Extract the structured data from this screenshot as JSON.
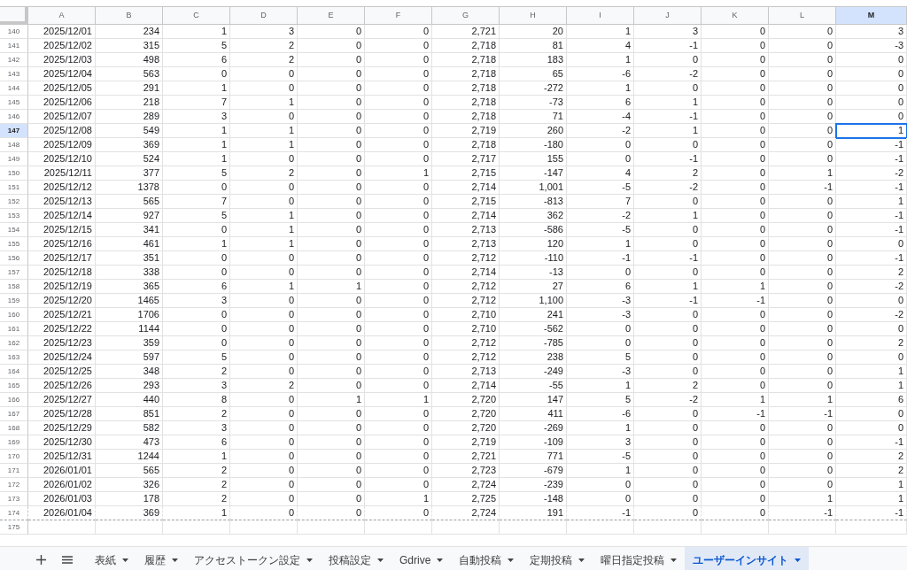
{
  "columns": [
    {
      "label": "A",
      "selected": false
    },
    {
      "label": "B",
      "selected": false
    },
    {
      "label": "C",
      "selected": false
    },
    {
      "label": "D",
      "selected": false
    },
    {
      "label": "E",
      "selected": false
    },
    {
      "label": "F",
      "selected": false
    },
    {
      "label": "G",
      "selected": false
    },
    {
      "label": "H",
      "selected": false
    },
    {
      "label": "I",
      "selected": false
    },
    {
      "label": "J",
      "selected": false
    },
    {
      "label": "K",
      "selected": false
    },
    {
      "label": "L",
      "selected": false
    },
    {
      "label": "M",
      "selected": true
    }
  ],
  "rows": [
    {
      "n": "140",
      "selected": false,
      "cells": [
        "2025/12/01",
        "234",
        "1",
        "3",
        "0",
        "0",
        "2,721",
        "20",
        "1",
        "3",
        "0",
        "0",
        "3"
      ]
    },
    {
      "n": "141",
      "selected": false,
      "cells": [
        "2025/12/02",
        "315",
        "5",
        "2",
        "0",
        "0",
        "2,718",
        "81",
        "4",
        "-1",
        "0",
        "0",
        "-3"
      ]
    },
    {
      "n": "142",
      "selected": false,
      "cells": [
        "2025/12/03",
        "498",
        "6",
        "2",
        "0",
        "0",
        "2,718",
        "183",
        "1",
        "0",
        "0",
        "0",
        "0"
      ]
    },
    {
      "n": "143",
      "selected": false,
      "cells": [
        "2025/12/04",
        "563",
        "0",
        "0",
        "0",
        "0",
        "2,718",
        "65",
        "-6",
        "-2",
        "0",
        "0",
        "0"
      ]
    },
    {
      "n": "144",
      "selected": false,
      "cells": [
        "2025/12/05",
        "291",
        "1",
        "0",
        "0",
        "0",
        "2,718",
        "-272",
        "1",
        "0",
        "0",
        "0",
        "0"
      ]
    },
    {
      "n": "145",
      "selected": false,
      "cells": [
        "2025/12/06",
        "218",
        "7",
        "1",
        "0",
        "0",
        "2,718",
        "-73",
        "6",
        "1",
        "0",
        "0",
        "0"
      ]
    },
    {
      "n": "146",
      "selected": false,
      "cells": [
        "2025/12/07",
        "289",
        "3",
        "0",
        "0",
        "0",
        "2,718",
        "71",
        "-4",
        "-1",
        "0",
        "0",
        "0"
      ]
    },
    {
      "n": "147",
      "selected": true,
      "cells": [
        "2025/12/08",
        "549",
        "1",
        "1",
        "0",
        "0",
        "2,719",
        "260",
        "-2",
        "1",
        "0",
        "0",
        "1"
      ]
    },
    {
      "n": "148",
      "selected": false,
      "cells": [
        "2025/12/09",
        "369",
        "1",
        "1",
        "0",
        "0",
        "2,718",
        "-180",
        "0",
        "0",
        "0",
        "0",
        "-1"
      ]
    },
    {
      "n": "149",
      "selected": false,
      "cells": [
        "2025/12/10",
        "524",
        "1",
        "0",
        "0",
        "0",
        "2,717",
        "155",
        "0",
        "-1",
        "0",
        "0",
        "-1"
      ]
    },
    {
      "n": "150",
      "selected": false,
      "cells": [
        "2025/12/11",
        "377",
        "5",
        "2",
        "0",
        "1",
        "2,715",
        "-147",
        "4",
        "2",
        "0",
        "1",
        "-2"
      ]
    },
    {
      "n": "151",
      "selected": false,
      "cells": [
        "2025/12/12",
        "1378",
        "0",
        "0",
        "0",
        "0",
        "2,714",
        "1,001",
        "-5",
        "-2",
        "0",
        "-1",
        "-1"
      ]
    },
    {
      "n": "152",
      "selected": false,
      "cells": [
        "2025/12/13",
        "565",
        "7",
        "0",
        "0",
        "0",
        "2,715",
        "-813",
        "7",
        "0",
        "0",
        "0",
        "1"
      ]
    },
    {
      "n": "153",
      "selected": false,
      "cells": [
        "2025/12/14",
        "927",
        "5",
        "1",
        "0",
        "0",
        "2,714",
        "362",
        "-2",
        "1",
        "0",
        "0",
        "-1"
      ]
    },
    {
      "n": "154",
      "selected": false,
      "cells": [
        "2025/12/15",
        "341",
        "0",
        "1",
        "0",
        "0",
        "2,713",
        "-586",
        "-5",
        "0",
        "0",
        "0",
        "-1"
      ]
    },
    {
      "n": "155",
      "selected": false,
      "cells": [
        "2025/12/16",
        "461",
        "1",
        "1",
        "0",
        "0",
        "2,713",
        "120",
        "1",
        "0",
        "0",
        "0",
        "0"
      ]
    },
    {
      "n": "156",
      "selected": false,
      "cells": [
        "2025/12/17",
        "351",
        "0",
        "0",
        "0",
        "0",
        "2,712",
        "-110",
        "-1",
        "-1",
        "0",
        "0",
        "-1"
      ]
    },
    {
      "n": "157",
      "selected": false,
      "cells": [
        "2025/12/18",
        "338",
        "0",
        "0",
        "0",
        "0",
        "2,714",
        "-13",
        "0",
        "0",
        "0",
        "0",
        "2"
      ]
    },
    {
      "n": "158",
      "selected": false,
      "cells": [
        "2025/12/19",
        "365",
        "6",
        "1",
        "1",
        "0",
        "2,712",
        "27",
        "6",
        "1",
        "1",
        "0",
        "-2"
      ]
    },
    {
      "n": "159",
      "selected": false,
      "cells": [
        "2025/12/20",
        "1465",
        "3",
        "0",
        "0",
        "0",
        "2,712",
        "1,100",
        "-3",
        "-1",
        "-1",
        "0",
        "0"
      ]
    },
    {
      "n": "160",
      "selected": false,
      "cells": [
        "2025/12/21",
        "1706",
        "0",
        "0",
        "0",
        "0",
        "2,710",
        "241",
        "-3",
        "0",
        "0",
        "0",
        "-2"
      ]
    },
    {
      "n": "161",
      "selected": false,
      "cells": [
        "2025/12/22",
        "1144",
        "0",
        "0",
        "0",
        "0",
        "2,710",
        "-562",
        "0",
        "0",
        "0",
        "0",
        "0"
      ]
    },
    {
      "n": "162",
      "selected": false,
      "cells": [
        "2025/12/23",
        "359",
        "0",
        "0",
        "0",
        "0",
        "2,712",
        "-785",
        "0",
        "0",
        "0",
        "0",
        "2"
      ]
    },
    {
      "n": "163",
      "selected": false,
      "cells": [
        "2025/12/24",
        "597",
        "5",
        "0",
        "0",
        "0",
        "2,712",
        "238",
        "5",
        "0",
        "0",
        "0",
        "0"
      ]
    },
    {
      "n": "164",
      "selected": false,
      "cells": [
        "2025/12/25",
        "348",
        "2",
        "0",
        "0",
        "0",
        "2,713",
        "-249",
        "-3",
        "0",
        "0",
        "0",
        "1"
      ]
    },
    {
      "n": "165",
      "selected": false,
      "cells": [
        "2025/12/26",
        "293",
        "3",
        "2",
        "0",
        "0",
        "2,714",
        "-55",
        "1",
        "2",
        "0",
        "0",
        "1"
      ]
    },
    {
      "n": "166",
      "selected": false,
      "cells": [
        "2025/12/27",
        "440",
        "8",
        "0",
        "1",
        "1",
        "2,720",
        "147",
        "5",
        "-2",
        "1",
        "1",
        "6"
      ]
    },
    {
      "n": "167",
      "selected": false,
      "cells": [
        "2025/12/28",
        "851",
        "2",
        "0",
        "0",
        "0",
        "2,720",
        "411",
        "-6",
        "0",
        "-1",
        "-1",
        "0"
      ]
    },
    {
      "n": "168",
      "selected": false,
      "cells": [
        "2025/12/29",
        "582",
        "3",
        "0",
        "0",
        "0",
        "2,720",
        "-269",
        "1",
        "0",
        "0",
        "0",
        "0"
      ]
    },
    {
      "n": "169",
      "selected": false,
      "cells": [
        "2025/12/30",
        "473",
        "6",
        "0",
        "0",
        "0",
        "2,719",
        "-109",
        "3",
        "0",
        "0",
        "0",
        "-1"
      ]
    },
    {
      "n": "170",
      "selected": false,
      "cells": [
        "2025/12/31",
        "1244",
        "1",
        "0",
        "0",
        "0",
        "2,721",
        "771",
        "-5",
        "0",
        "0",
        "0",
        "2"
      ]
    },
    {
      "n": "171",
      "selected": false,
      "cells": [
        "2026/01/01",
        "565",
        "2",
        "0",
        "0",
        "0",
        "2,723",
        "-679",
        "1",
        "0",
        "0",
        "0",
        "2"
      ]
    },
    {
      "n": "172",
      "selected": false,
      "cells": [
        "2026/01/02",
        "326",
        "2",
        "0",
        "0",
        "0",
        "2,724",
        "-239",
        "0",
        "0",
        "0",
        "0",
        "1"
      ]
    },
    {
      "n": "173",
      "selected": false,
      "cells": [
        "2026/01/03",
        "178",
        "2",
        "0",
        "0",
        "1",
        "2,725",
        "-148",
        "0",
        "0",
        "0",
        "1",
        "1"
      ]
    },
    {
      "n": "174",
      "selected": false,
      "cells": [
        "2026/01/04",
        "369",
        "1",
        "0",
        "0",
        "0",
        "2,724",
        "191",
        "-1",
        "0",
        "0",
        "-1",
        "-1"
      ]
    },
    {
      "n": "175",
      "selected": false
    }
  ],
  "sheet_tabs": [
    {
      "label": "表紙",
      "selected": false
    },
    {
      "label": "履歴",
      "selected": false
    },
    {
      "label": "アクセストークン設定",
      "selected": false
    },
    {
      "label": "投稿設定",
      "selected": false
    },
    {
      "label": "Gdrive",
      "selected": false
    },
    {
      "label": "自動投稿",
      "selected": false
    },
    {
      "label": "定期投稿",
      "selected": false
    },
    {
      "label": "曜日指定投稿",
      "selected": false
    },
    {
      "label": "ユーザーインサイト",
      "selected": true
    }
  ]
}
